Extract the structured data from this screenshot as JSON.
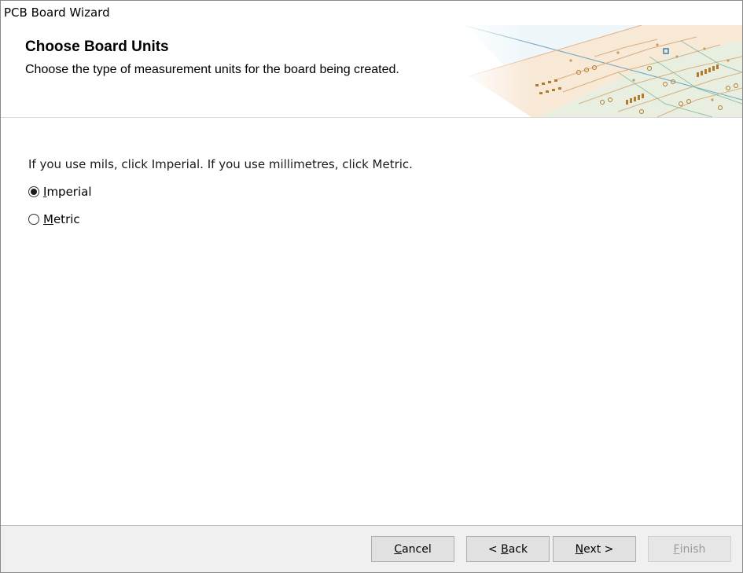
{
  "window": {
    "title": "PCB Board Wizard"
  },
  "header": {
    "title": "Choose Board Units",
    "subtitle": "Choose the type of measurement units for the board being created."
  },
  "content": {
    "instruction": "If you use mils, click Imperial. If you use millimetres, click Metric.",
    "options": [
      {
        "mnemonic": "I",
        "rest": "mperial",
        "selected": true
      },
      {
        "mnemonic": "M",
        "rest": "etric",
        "selected": false
      }
    ]
  },
  "buttons": {
    "cancel": {
      "mnemonic": "C",
      "rest": "ancel"
    },
    "back": {
      "prefix": "< ",
      "mnemonic": "B",
      "rest": "ack"
    },
    "next": {
      "mnemonic": "N",
      "rest": "ext >"
    },
    "finish": {
      "mnemonic": "F",
      "rest": "inish",
      "disabled": true
    }
  },
  "colors": {
    "banner_board": "#f7e6d3",
    "banner_green": "#dfeede",
    "trace": "#d6a96a",
    "pad": "#b07020"
  }
}
